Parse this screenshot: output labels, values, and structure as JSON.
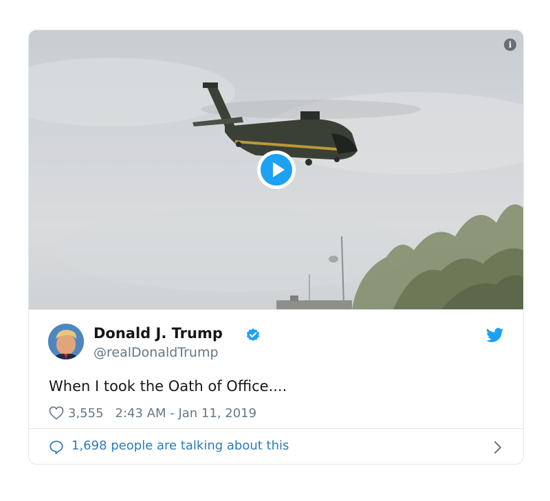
{
  "tweet": {
    "author_name": "Donald J. Trump",
    "author_handle": "@realDonaldTrump",
    "text": "When I took the Oath of Office....",
    "like_count": "3,555",
    "timestamp": "2:43 AM - Jan 11, 2019",
    "talking_text": "1,698 people are talking about this"
  },
  "media": {
    "type": "video",
    "play_icon": "play-icon",
    "info_icon": "info-icon"
  },
  "icons": {
    "verified": "verified-badge-icon",
    "brand": "twitter-bird-icon",
    "like": "heart-icon",
    "reply": "speech-bubble-icon",
    "more": "chevron-right-icon"
  },
  "colors": {
    "accent": "#1da1f2",
    "link": "#2b7bb9",
    "secondary_text": "#657786",
    "primary_text": "#14171a",
    "border": "#e1e8ed"
  }
}
